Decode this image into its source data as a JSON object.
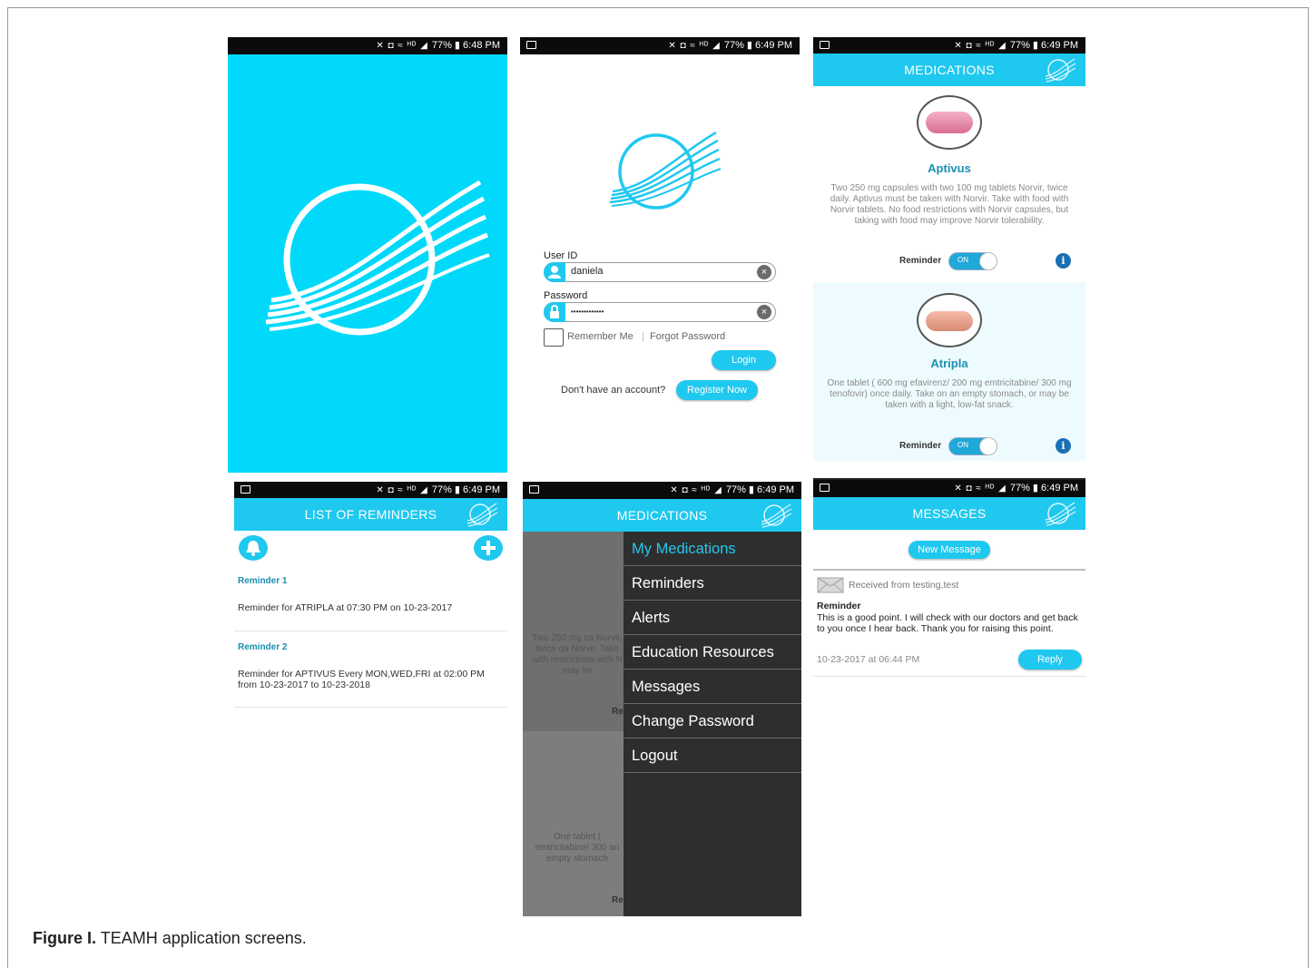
{
  "status": {
    "icons": "✕ ◘ ≈ ᴴᴰ ◢",
    "battery": "77%",
    "time_1": "6:48 PM",
    "time_2": "6:49 PM"
  },
  "login": {
    "user_id_label": "User ID",
    "user_id_value": "daniela",
    "password_label": "Password",
    "password_value": "•••••••••••••",
    "remember_me": "Remember Me",
    "separator": "|",
    "forgot_password": "Forgot Password",
    "login_button": "Login",
    "no_account": "Don't have an account?",
    "register_button": "Register Now"
  },
  "medications": {
    "title": "MEDICATIONS",
    "items": [
      {
        "name": "Aptivus",
        "description": "Two 250 mg capsules with two 100 mg tablets Norvir, twice daily. Aptivus must be taken with Norvir. Take with food with Norvir tablets. No food restrictions with Norvir capsules, but taking with food may improve Norvir tolerability.",
        "reminder_label": "Reminder",
        "toggle": "ON"
      },
      {
        "name": "Atripla",
        "description": "One tablet ( 600 mg efavirenz/ 200 mg emtricitabine/ 300 mg tenofovir) once daily. Take on an empty stomach, or may be taken with a light, low-fat snack.",
        "reminder_label": "Reminder",
        "toggle": "ON"
      }
    ]
  },
  "reminders": {
    "title": "LIST OF REMINDERS",
    "items": [
      {
        "title": "Reminder 1",
        "text": "Reminder for ATRIPLA at 07:30 PM on 10-23-2017"
      },
      {
        "title": "Reminder 2",
        "text": "Reminder for APTIVUS Every MON,WED,FRI at 02:00 PM from 10-23-2017 to 10-23-2018"
      }
    ]
  },
  "drawer": {
    "title": "MEDICATIONS",
    "bg_text_1": "Two 250 mg ca Norvir, twice da Norvir. Take with restrictions with N may im",
    "bg_text_2": "Re",
    "bg_text_3": "One tablet ( emtricitabine/ 300 an empty stomach",
    "bg_text_4": "Re",
    "items": [
      "My Medications",
      "Reminders",
      "Alerts",
      "Education Resources",
      "Messages",
      "Change Password",
      "Logout"
    ]
  },
  "messages": {
    "title": "MESSAGES",
    "new_message": "New Message",
    "received_from": "Received from testing,test",
    "subject": "Reminder",
    "body": "This is a good point. I will check with our doctors and get back to you once I hear back. Thank you for raising this point.",
    "date": "10-23-2017 at 06:44 PM",
    "reply": "Reply"
  },
  "caption": {
    "label": "Figure I.",
    "text": "TEAMH application screens."
  },
  "colors": {
    "brand": "#1fc8ef",
    "splash": "#00d9f9",
    "drawer": "#2e2e2e",
    "title_blue": "#1a8fb0"
  }
}
